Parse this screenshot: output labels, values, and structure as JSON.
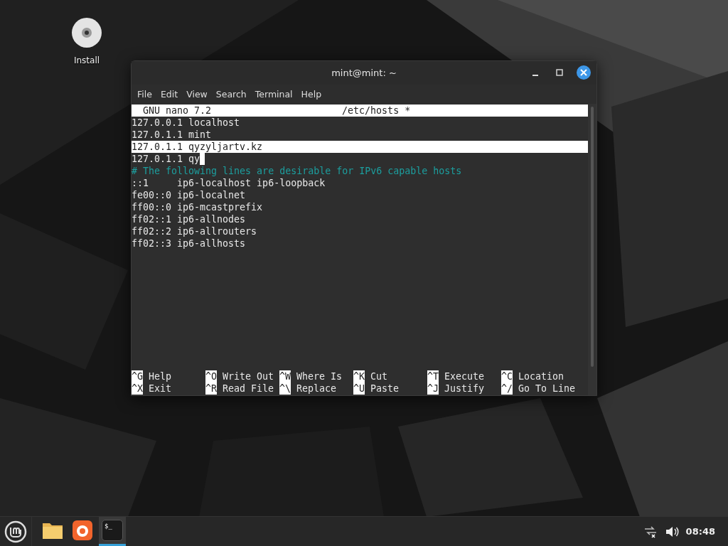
{
  "desktop": {
    "icons": [
      {
        "label": "Install"
      }
    ]
  },
  "window": {
    "title": "mint@mint: ~",
    "menu": [
      "File",
      "Edit",
      "View",
      "Search",
      "Terminal",
      "Help"
    ]
  },
  "nano": {
    "header": {
      "version": "GNU nano 7.2",
      "file": "/etc/hosts *"
    },
    "lines": [
      {
        "text": "127.0.0.1 localhost",
        "kind": "text",
        "highlighted": false,
        "cursor": false
      },
      {
        "text": "127.0.1.1 mint",
        "kind": "text",
        "highlighted": false,
        "cursor": false
      },
      {
        "text": "127.0.1.1 qyzyljartv.kz",
        "kind": "text",
        "highlighted": true,
        "cursor": false
      },
      {
        "text": "127.0.1.1 qy",
        "kind": "text",
        "highlighted": false,
        "cursor": true
      },
      {
        "text": "# The following lines are desirable for IPv6 capable hosts",
        "kind": "comment",
        "highlighted": false,
        "cursor": false
      },
      {
        "text": "::1     ip6-localhost ip6-loopback",
        "kind": "text",
        "highlighted": false,
        "cursor": false
      },
      {
        "text": "fe00::0 ip6-localnet",
        "kind": "text",
        "highlighted": false,
        "cursor": false
      },
      {
        "text": "ff00::0 ip6-mcastprefix",
        "kind": "text",
        "highlighted": false,
        "cursor": false
      },
      {
        "text": "ff02::1 ip6-allnodes",
        "kind": "text",
        "highlighted": false,
        "cursor": false
      },
      {
        "text": "ff02::2 ip6-allrouters",
        "kind": "text",
        "highlighted": false,
        "cursor": false
      },
      {
        "text": "ff02::3 ip6-allhosts",
        "kind": "text",
        "highlighted": false,
        "cursor": false
      }
    ],
    "shortcuts": [
      [
        {
          "key": "^G",
          "label": "Help"
        },
        {
          "key": "^O",
          "label": "Write Out"
        },
        {
          "key": "^W",
          "label": "Where Is"
        },
        {
          "key": "^K",
          "label": "Cut"
        },
        {
          "key": "^T",
          "label": "Execute"
        },
        {
          "key": "^C",
          "label": "Location"
        }
      ],
      [
        {
          "key": "^X",
          "label": "Exit"
        },
        {
          "key": "^R",
          "label": "Read File"
        },
        {
          "key": "^\\",
          "label": "Replace"
        },
        {
          "key": "^U",
          "label": "Paste"
        },
        {
          "key": "^J",
          "label": "Justify"
        },
        {
          "key": "^/",
          "label": "Go To Line"
        }
      ]
    ]
  },
  "taskbar": {
    "apps": [
      {
        "kind": "files",
        "active": false
      },
      {
        "kind": "firefox",
        "active": false
      },
      {
        "kind": "terminal",
        "active": true,
        "glyph": "$_"
      }
    ],
    "clock": "08:48"
  }
}
